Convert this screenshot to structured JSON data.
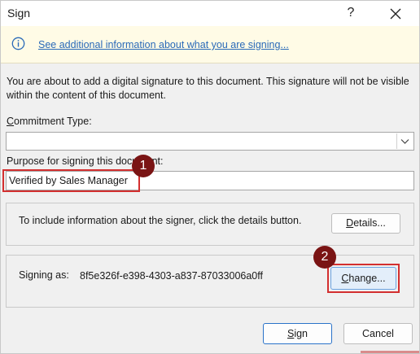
{
  "window": {
    "title": "Sign",
    "help_label": "?"
  },
  "infobar": {
    "link_text": "See additional information about what you are signing..."
  },
  "intro_text": "You are about to add a digital signature to this document. This signature will not be visible within the content of this document.",
  "commitment": {
    "label_first": "C",
    "label_rest": "ommitment Type:",
    "value": ""
  },
  "purpose": {
    "label": "Purpose for signing this document:",
    "value": "Verified by Sales Manager"
  },
  "details_group": {
    "text": "To include information about the signer, click the details button.",
    "button_first": "D",
    "button_rest": "etails..."
  },
  "signing_group": {
    "label": "Signing as:",
    "identity": "8f5e326f-e398-4303-a837-87033006a0ff",
    "button_first": "C",
    "button_rest": "hange..."
  },
  "buttons": {
    "sign_first": "S",
    "sign_rest": "ign",
    "cancel": "Cancel"
  },
  "annotations": {
    "step1": "1",
    "step2": "2",
    "highlight_color": "#d32f2f",
    "badge_color": "#7a1414"
  }
}
